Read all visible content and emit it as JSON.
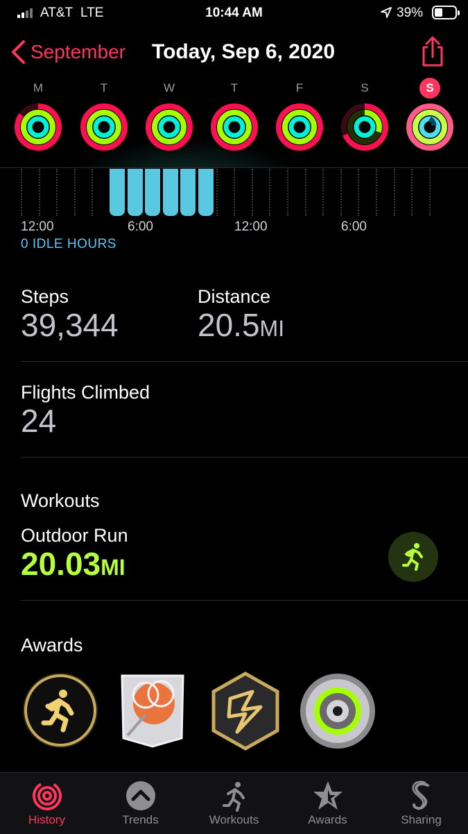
{
  "status_bar": {
    "carrier": "AT&T",
    "network": "LTE",
    "time": "10:44 AM",
    "battery_percent": "39%",
    "battery_level": 0.39
  },
  "nav": {
    "back_label": "September",
    "title": "Today, Sep 6, 2020"
  },
  "week": {
    "days": [
      {
        "label": "M",
        "today": false
      },
      {
        "label": "T",
        "today": false
      },
      {
        "label": "W",
        "today": false
      },
      {
        "label": "T",
        "today": false
      },
      {
        "label": "F",
        "today": false
      },
      {
        "label": "S",
        "today": false
      },
      {
        "label": "S",
        "today": true
      }
    ]
  },
  "hourly": {
    "ticks": [
      "12:00",
      "6:00",
      "12:00",
      "6:00"
    ],
    "idle_label": "0 IDLE HOURS"
  },
  "steps": {
    "label": "Steps",
    "value": "39,344"
  },
  "distance": {
    "label": "Distance",
    "value": "20.5",
    "unit": "MI"
  },
  "flights": {
    "label": "Flights Climbed",
    "value": "24"
  },
  "workouts": {
    "heading": "Workouts",
    "name": "Outdoor Run",
    "value": "20.03",
    "unit": "MI",
    "icon": "running-figure-icon"
  },
  "awards": {
    "heading": "Awards",
    "items": [
      "outdoor-run-award-icon",
      "tennis-ball-award-icon",
      "hexagon-lightning-award-icon",
      "move-goal-ring-award-icon"
    ]
  },
  "tabs": [
    {
      "label": "History",
      "icon": "history-rings-icon",
      "active": true
    },
    {
      "label": "Trends",
      "icon": "trends-chevron-icon",
      "active": false
    },
    {
      "label": "Workouts",
      "icon": "workouts-runner-icon",
      "active": false
    },
    {
      "label": "Awards",
      "icon": "awards-star-icon",
      "active": false
    },
    {
      "label": "Sharing",
      "icon": "sharing-s-icon",
      "active": false
    }
  ],
  "colors": {
    "accent": "#ff375f",
    "move": "#fa114f",
    "exercise": "#a6ff00",
    "stand": "#00f0d8",
    "workout_value": "#b6ff3b"
  }
}
